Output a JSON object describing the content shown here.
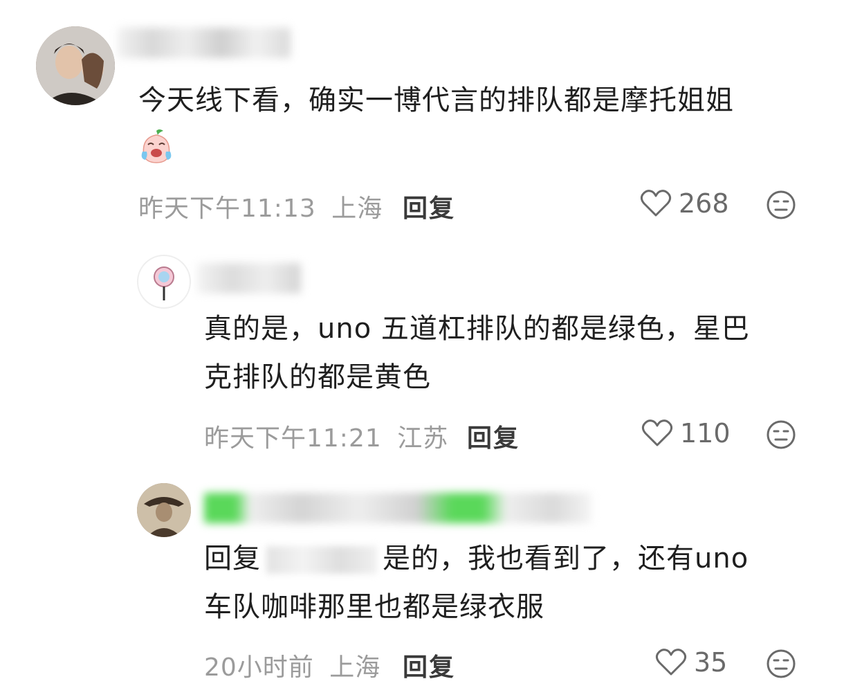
{
  "comments": [
    {
      "text_line1": "今天线下看，确实一博代言的排队都是摩托姐姐",
      "emoji": "crying-peach-emoji",
      "time": "昨天下午11:13",
      "location": "上海",
      "reply_label": "回复",
      "likes": "268"
    },
    {
      "text_line1": "真的是，uno 五道杠排队的都是绿色，星巴",
      "text_line2": "克排队的都是黄色",
      "time": "昨天下午11:21",
      "location": "江苏",
      "reply_label": "回复",
      "likes": "110"
    },
    {
      "reply_prefix": "回复",
      "text_line1_after": "是的，我也看到了，还有uno",
      "text_line2": "车队咖啡那里也都是绿衣服",
      "time": "20小时前",
      "location": "上海",
      "reply_label": "回复",
      "likes": "35"
    }
  ],
  "colors": {
    "meta": "#9b9b9b",
    "text": "#1f1f1f",
    "highlight_green": "#5ad85a"
  }
}
